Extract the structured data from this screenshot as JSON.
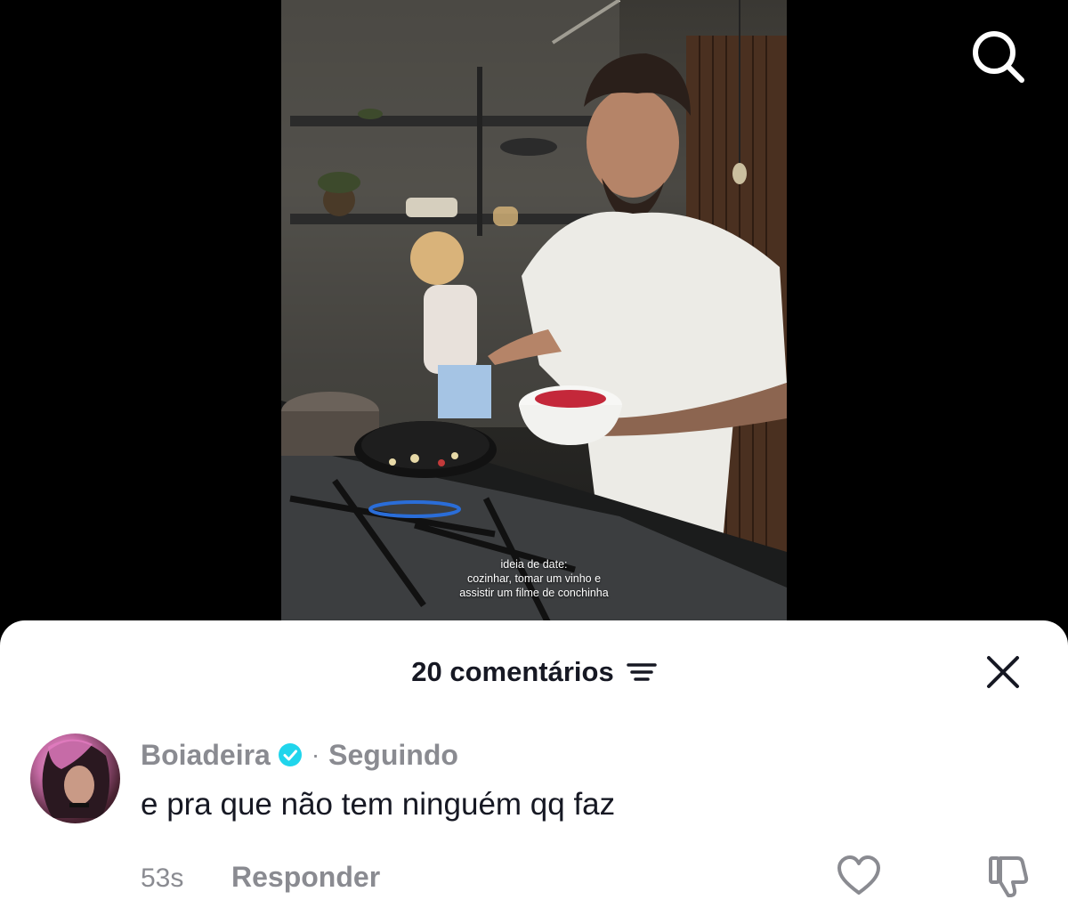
{
  "video": {
    "caption_lines": [
      "ideia de date:",
      "cozinhar, tomar um vinho e",
      "assistir um filme de conchinha"
    ]
  },
  "icons": {
    "search": "search-icon",
    "sort": "sort-icon",
    "close": "close-icon",
    "verified": "verified-badge-icon",
    "like": "heart-icon",
    "dislike": "thumbs-down-icon"
  },
  "comments_sheet": {
    "title": "20 comentários",
    "comment": {
      "username": "Boiadeira",
      "separator": "·",
      "following_label": "Seguindo",
      "text": "e pra que não tem ninguém qq faz",
      "time": "53s",
      "reply_label": "Responder"
    }
  },
  "colors": {
    "verified": "#20D5EC",
    "text_primary": "#161823",
    "text_secondary": "#8A8B91"
  }
}
